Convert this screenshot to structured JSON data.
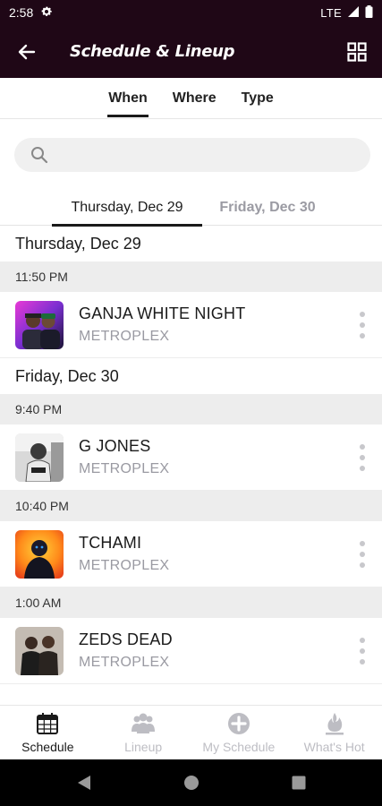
{
  "status_bar": {
    "time": "2:58",
    "network": "LTE"
  },
  "app_bar": {
    "title": "Schedule & Lineup"
  },
  "filter_tabs": [
    {
      "label": "When",
      "active": true
    },
    {
      "label": "Where",
      "active": false
    },
    {
      "label": "Type",
      "active": false
    }
  ],
  "search": {
    "placeholder": ""
  },
  "day_tabs": [
    {
      "label": "Thursday, Dec 29",
      "active": true
    },
    {
      "label": "Friday, Dec 30",
      "active": false
    }
  ],
  "days": [
    {
      "label": "Thursday, Dec 29",
      "slots": [
        {
          "time": "11:50 PM",
          "acts": [
            {
              "name": "GANJA WHITE NIGHT",
              "venue": "METROPLEX"
            }
          ]
        }
      ]
    },
    {
      "label": "Friday, Dec 30",
      "slots": [
        {
          "time": "9:40 PM",
          "acts": [
            {
              "name": "G JONES",
              "venue": "METROPLEX"
            }
          ]
        },
        {
          "time": "10:40 PM",
          "acts": [
            {
              "name": "TCHAMI",
              "venue": "METROPLEX"
            }
          ]
        },
        {
          "time": "1:00 AM",
          "acts": [
            {
              "name": "ZEDS DEAD",
              "venue": "METROPLEX"
            }
          ]
        }
      ]
    }
  ],
  "bottom_nav": [
    {
      "label": "Schedule",
      "icon": "calendar-icon",
      "active": true
    },
    {
      "label": "Lineup",
      "icon": "people-icon",
      "active": false
    },
    {
      "label": "My Schedule",
      "icon": "plus-circle-icon",
      "active": false
    },
    {
      "label": "What's Hot",
      "icon": "flame-icon",
      "active": false
    }
  ],
  "colors": {
    "app_bar": "#1f0716",
    "inactive": "#9b9ba3",
    "section_bg": "#ededed"
  }
}
